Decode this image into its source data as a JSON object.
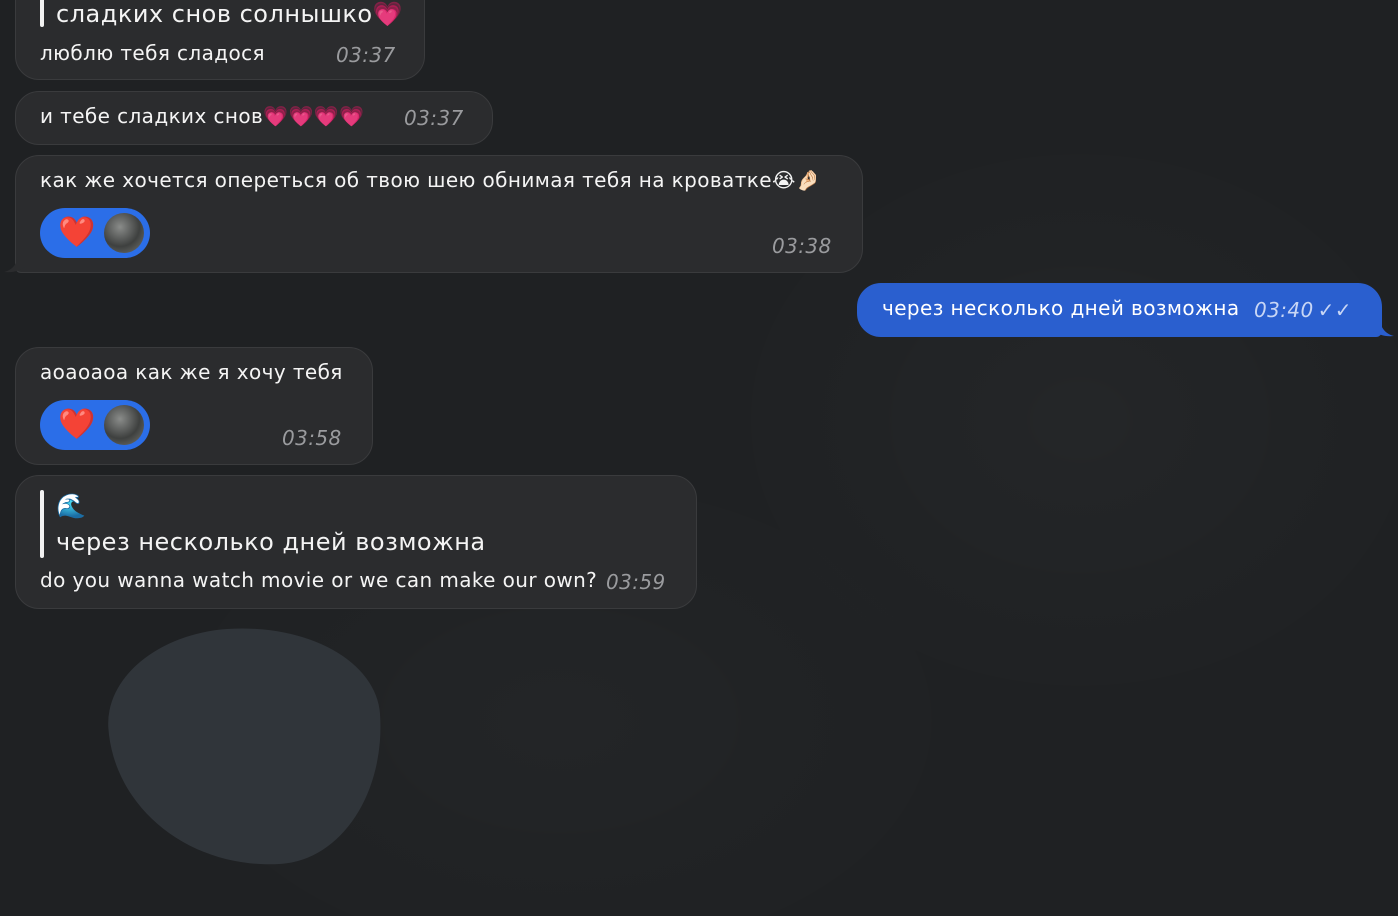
{
  "messages": [
    {
      "quote": "сладких снов солнышко💗",
      "text": "люблю тебя сладося",
      "time": "03:37"
    },
    {
      "text": "и тебе сладких снов💗💗💗💗",
      "time": "03:37"
    },
    {
      "text": "как же хочется опереться об твою шею обнимая тебя на кроватке😭🤌🏻",
      "reaction": "❤️",
      "time": "03:38"
    },
    {
      "text": "через несколько дней возможна",
      "time": "03:40",
      "status": "read"
    },
    {
      "text": "аоаоаоа как же я хочу тебя",
      "reaction": "❤️",
      "time": "03:58"
    },
    {
      "quote_title": "🌊",
      "quote": "через несколько дней возможна",
      "text": "do you wanna watch movie or we can make our own?",
      "time": "03:59"
    }
  ],
  "icons": {
    "read_status": "double-check-icon",
    "reaction_avatar": "avatar"
  },
  "colors": {
    "background": "#1f2123",
    "incoming_bubble": "#2b2c2e",
    "outgoing_bubble": "#2a5fcf",
    "reaction_pill": "#2b6ee8"
  }
}
